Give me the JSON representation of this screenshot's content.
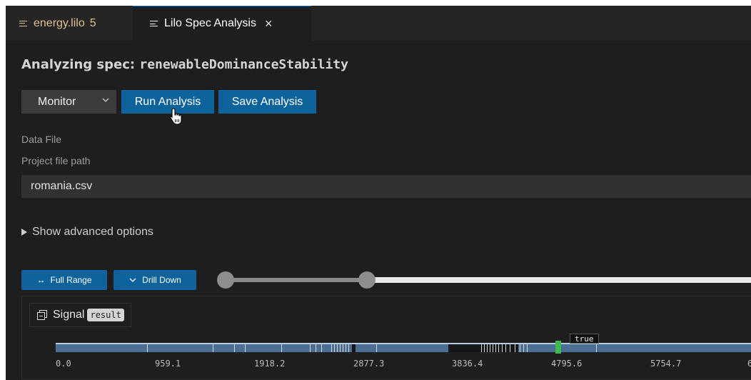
{
  "tabs": [
    {
      "label": "energy.lilo",
      "count": "5",
      "icon": "lines-icon"
    },
    {
      "label": "Lilo Spec Analysis",
      "close": "×",
      "icon": "lines-icon"
    }
  ],
  "header": {
    "prefix": "Analyzing spec: ",
    "spec_name": "renewableDominanceStability"
  },
  "controls": {
    "mode_value": "Monitor",
    "run_label": "Run Analysis",
    "save_label": "Save Analysis"
  },
  "data_file": {
    "section_label": "Data File",
    "field_label": "Project file path",
    "value": "romania.csv"
  },
  "advanced": {
    "label": "Show advanced options"
  },
  "range": {
    "full_label": "Full Range",
    "drill_label": "Drill Down",
    "selection_fraction": [
      0.0,
      0.265
    ]
  },
  "signal": {
    "label": "Signal",
    "chip": "result",
    "tooltip": "true"
  },
  "axis_ticks": [
    "0.0",
    "959.1",
    "1918.2",
    "2877.3",
    "3836.4",
    "4795.6",
    "5754.7",
    "6"
  ],
  "colors": {
    "accent": "#0e639c",
    "true_marker": "#3fb950",
    "track": "#4b6e92"
  }
}
